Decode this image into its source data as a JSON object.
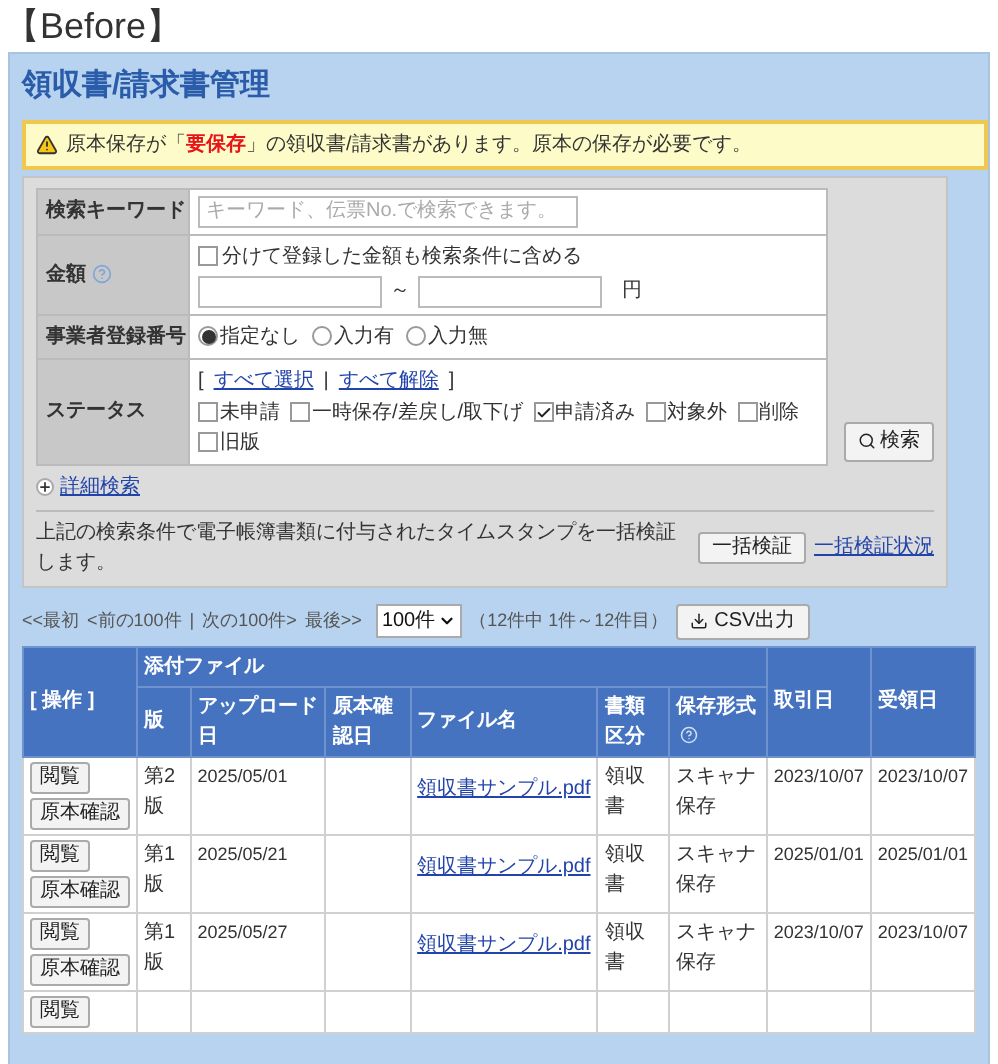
{
  "heading": "【Before】",
  "page_title": "領収書/請求書管理",
  "alert": {
    "text": "原本保存が「**要保存**」の領収書/請求書があります。原本の保存が必要です。"
  },
  "search_form": {
    "rows": [
      {
        "kind": "keyword",
        "label": "検索キーワード",
        "placeholder": "キーワード、伝票No.で検索できます。"
      },
      {
        "kind": "amount",
        "label": "金額",
        "checkbox": {
          "label": "分けて登録した金額も検索条件に含める",
          "checked": false
        },
        "separator": "～",
        "unit": "円"
      },
      {
        "kind": "radio",
        "label": "事業者登録番号",
        "options": [
          {
            "label": "指定なし",
            "selected": true
          },
          {
            "label": "入力有",
            "selected": false
          },
          {
            "label": "入力無",
            "selected": false
          }
        ]
      },
      {
        "kind": "status",
        "label": "ステータス",
        "bracket_open": "[",
        "select_all": "すべて選択",
        "divider": "|",
        "clear_all": "すべて解除",
        "bracket_close": "]",
        "options": [
          {
            "label": "未申請",
            "checked": false
          },
          {
            "label": "一時保存/差戻し/取下げ",
            "checked": false
          },
          {
            "label": "申請済み",
            "checked": true
          },
          {
            "label": "対象外",
            "checked": false
          },
          {
            "label": "削除",
            "checked": false
          },
          {
            "label": "旧版",
            "checked": false
          }
        ]
      }
    ],
    "search_button": "検索",
    "advanced_link": "詳細検索",
    "bulk_text": "上記の検索条件で電子帳簿書類に付与されたタイムスタンプを一括検証します。",
    "bulk_button": "一括検証",
    "bulk_status_link": "一括検証状況"
  },
  "pagination": {
    "first": "<<最初",
    "prev": "<前の100件",
    "divider": "|",
    "next": "次の100件>",
    "last": "最後>>",
    "page_size": "100件",
    "range": "（12件中 1件～12件目）",
    "csv_button": "CSV出力"
  },
  "table": {
    "action_header": "[ 操作 ]",
    "group_header": "添付ファイル",
    "sub_columns": [
      "版",
      "アップロード日",
      "原本確認日",
      "ファイル名",
      "書類区分",
      "保存形式"
    ],
    "trailing_columns": [
      "取引日",
      "受領日"
    ],
    "rows": [
      {
        "buttons": [
          "閲覧",
          "原本確認"
        ],
        "edition": "第2版",
        "upload_date": "2025/05/01",
        "file_name": "領収書サンプル.pdf",
        "doc_type": "領収書",
        "storage": "スキャナ保存",
        "transaction_date": "2023/10/07",
        "received_date": "2023/10/07"
      },
      {
        "buttons": [
          "閲覧",
          "原本確認"
        ],
        "edition": "第1版",
        "upload_date": "2025/05/21",
        "file_name": "領収書サンプル.pdf",
        "doc_type": "領収書",
        "storage": "スキャナ保存",
        "transaction_date": "2025/01/01",
        "received_date": "2025/01/01"
      },
      {
        "buttons": [
          "閲覧",
          "原本確認"
        ],
        "edition": "第1版",
        "upload_date": "2025/05/27",
        "file_name": "領収書サンプル.pdf",
        "doc_type": "領収書",
        "storage": "スキャナ保存",
        "transaction_date": "2023/10/07",
        "received_date": "2023/10/07"
      },
      {
        "buttons": [
          "閲覧"
        ]
      }
    ]
  }
}
